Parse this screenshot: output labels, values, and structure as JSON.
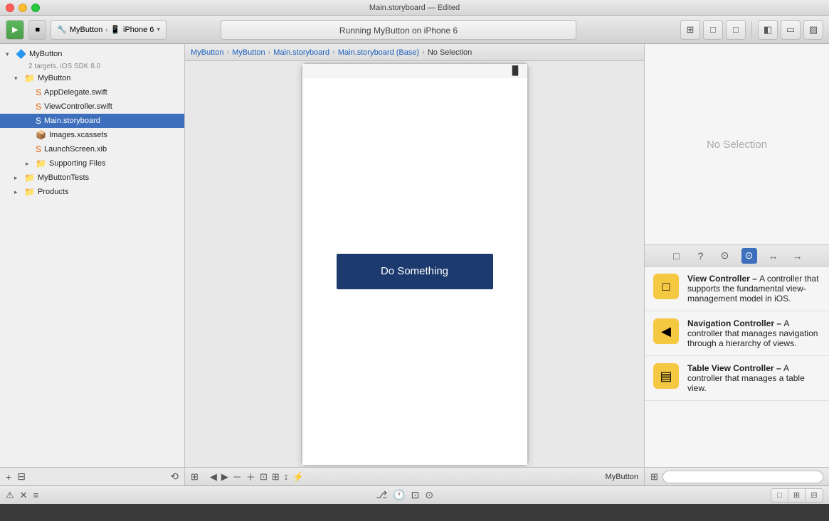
{
  "titleBar": {
    "title": "Main.storyboard — Edited"
  },
  "toolbar": {
    "playLabel": "▶",
    "stopLabel": "■",
    "schemeName": "MyButton",
    "deviceName": "iPhone 6",
    "runningText": "Running MyButton on iPhone 6",
    "icons": {
      "layout": "⊞",
      "panel1": "□",
      "panel2": "□",
      "panel3": "□",
      "left": "◧",
      "middle": "▭",
      "right": "▨"
    }
  },
  "breadcrumb": {
    "items": [
      "MyButton",
      "MyButton",
      "Main.storyboard",
      "Main.storyboard (Base)",
      "No Selection"
    ]
  },
  "sidebar": {
    "projectName": "MyButton",
    "projectSubtitle": "2 targets, iOS SDK 8.0",
    "items": [
      {
        "label": "MyButton",
        "level": 1,
        "type": "group",
        "expanded": true
      },
      {
        "label": "AppDelegate.swift",
        "level": 2,
        "type": "swift"
      },
      {
        "label": "ViewController.swift",
        "level": 2,
        "type": "swift"
      },
      {
        "label": "Main.storyboard",
        "level": 2,
        "type": "storyboard",
        "selected": true
      },
      {
        "label": "Images.xcassets",
        "level": 2,
        "type": "assets"
      },
      {
        "label": "LaunchScreen.xib",
        "level": 2,
        "type": "xib"
      },
      {
        "label": "Supporting Files",
        "level": 2,
        "type": "folder",
        "expanded": false
      },
      {
        "label": "MyButtonTests",
        "level": 1,
        "type": "folder",
        "expanded": false
      },
      {
        "label": "Products",
        "level": 1,
        "type": "folder",
        "expanded": false
      }
    ],
    "addBtnLabel": "+",
    "filterBtnLabel": "⊟",
    "historyBtnLabel": "⟲"
  },
  "canvas": {
    "buttonText": "Do Something",
    "batteryIcon": "▐▌",
    "arrowText": "→"
  },
  "inspector": {
    "noSelectionText": "No Selection",
    "icons": {
      "file": "□",
      "code": "{}",
      "circle": "◎",
      "layout": "□"
    },
    "libraryItems": [
      {
        "title": "View Controller",
        "description": "A controller that supports the fundamental view-management model in iOS.",
        "icon": "□"
      },
      {
        "title": "Navigation Controller",
        "description": "A controller that manages navigation through a hierarchy of views.",
        "icon": "◀"
      },
      {
        "title": "Table View Controller",
        "description": "A controller that manages a table view.",
        "icon": "▤"
      }
    ]
  },
  "bottomBar": {
    "mybuttonLabel": "MyButton",
    "searchPlaceholder": "",
    "icons": {
      "warning": "⚠",
      "error": "✕",
      "filter": "≡",
      "branch": "⎇",
      "grid": "⊞",
      "magnifier": "⌕"
    }
  }
}
